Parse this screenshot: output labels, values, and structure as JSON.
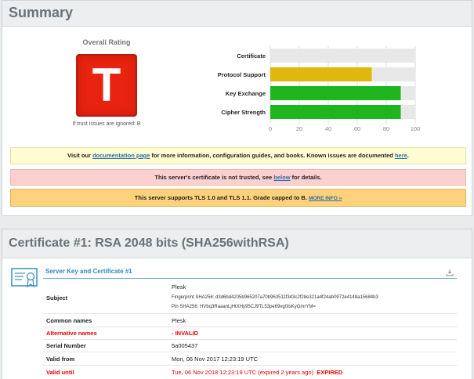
{
  "summary": {
    "title": "Summary",
    "rating_label": "Overall Rating",
    "grade": "T",
    "grade_note": "If trust issues are ignored: B",
    "notices": {
      "doc_pre": "Visit our ",
      "doc_link": "documentation page",
      "doc_mid": " for more information, configuration guides, and books. Known issues are documented ",
      "doc_link2": "here",
      "doc_post": ".",
      "trust_pre": "This server's certificate is not trusted, see ",
      "trust_link": "below",
      "trust_post": " for details.",
      "tls_text": "This server supports TLS 1.0 and TLS 1.1. Grade capped to B. ",
      "tls_link": "MORE INFO »"
    }
  },
  "chart_data": {
    "type": "bar",
    "orientation": "horizontal",
    "categories": [
      "Certificate",
      "Protocol Support",
      "Key Exchange",
      "Cipher Strength"
    ],
    "values": [
      0,
      70,
      90,
      90
    ],
    "xlim": [
      0,
      100
    ],
    "ticks": [
      0,
      20,
      40,
      60,
      80,
      100
    ],
    "bar_colors": [
      "#e6e6e6",
      "#e0b70d",
      "#1eb51e",
      "#1eb51e"
    ],
    "grid": true
  },
  "certificate": {
    "title": "Certificate #1: RSA 2048 bits (SHA256withRSA)",
    "section_title": "Server Key and Certificate #1",
    "rows": {
      "subject": {
        "label": "Subject",
        "value": "Plesk",
        "fp": "Fingerprint SHA256: d3d6bd4205b965207a70b963511f343c2f28e321a4f24ab0972e4148a15684b3",
        "pin": "Pin SHA256: HVbq3RaaanLjHtXHy95CJ9TL53pe69vg0IsKyGmrYM="
      },
      "common_names": {
        "label": "Common names",
        "value": "Plesk"
      },
      "alt_names": {
        "label": "Alternative names",
        "value": "-   INVALID"
      },
      "serial": {
        "label": "Serial Number",
        "value": "5a005437"
      },
      "valid_from": {
        "label": "Valid from",
        "value": "Mon, 06 Nov 2017 12:23:19 UTC"
      },
      "valid_until": {
        "label": "Valid until",
        "value": "Tue, 06 Nov 2018 12:23:19 UTC (expired 2 years ago)",
        "flag": "EXPIRED"
      }
    }
  }
}
